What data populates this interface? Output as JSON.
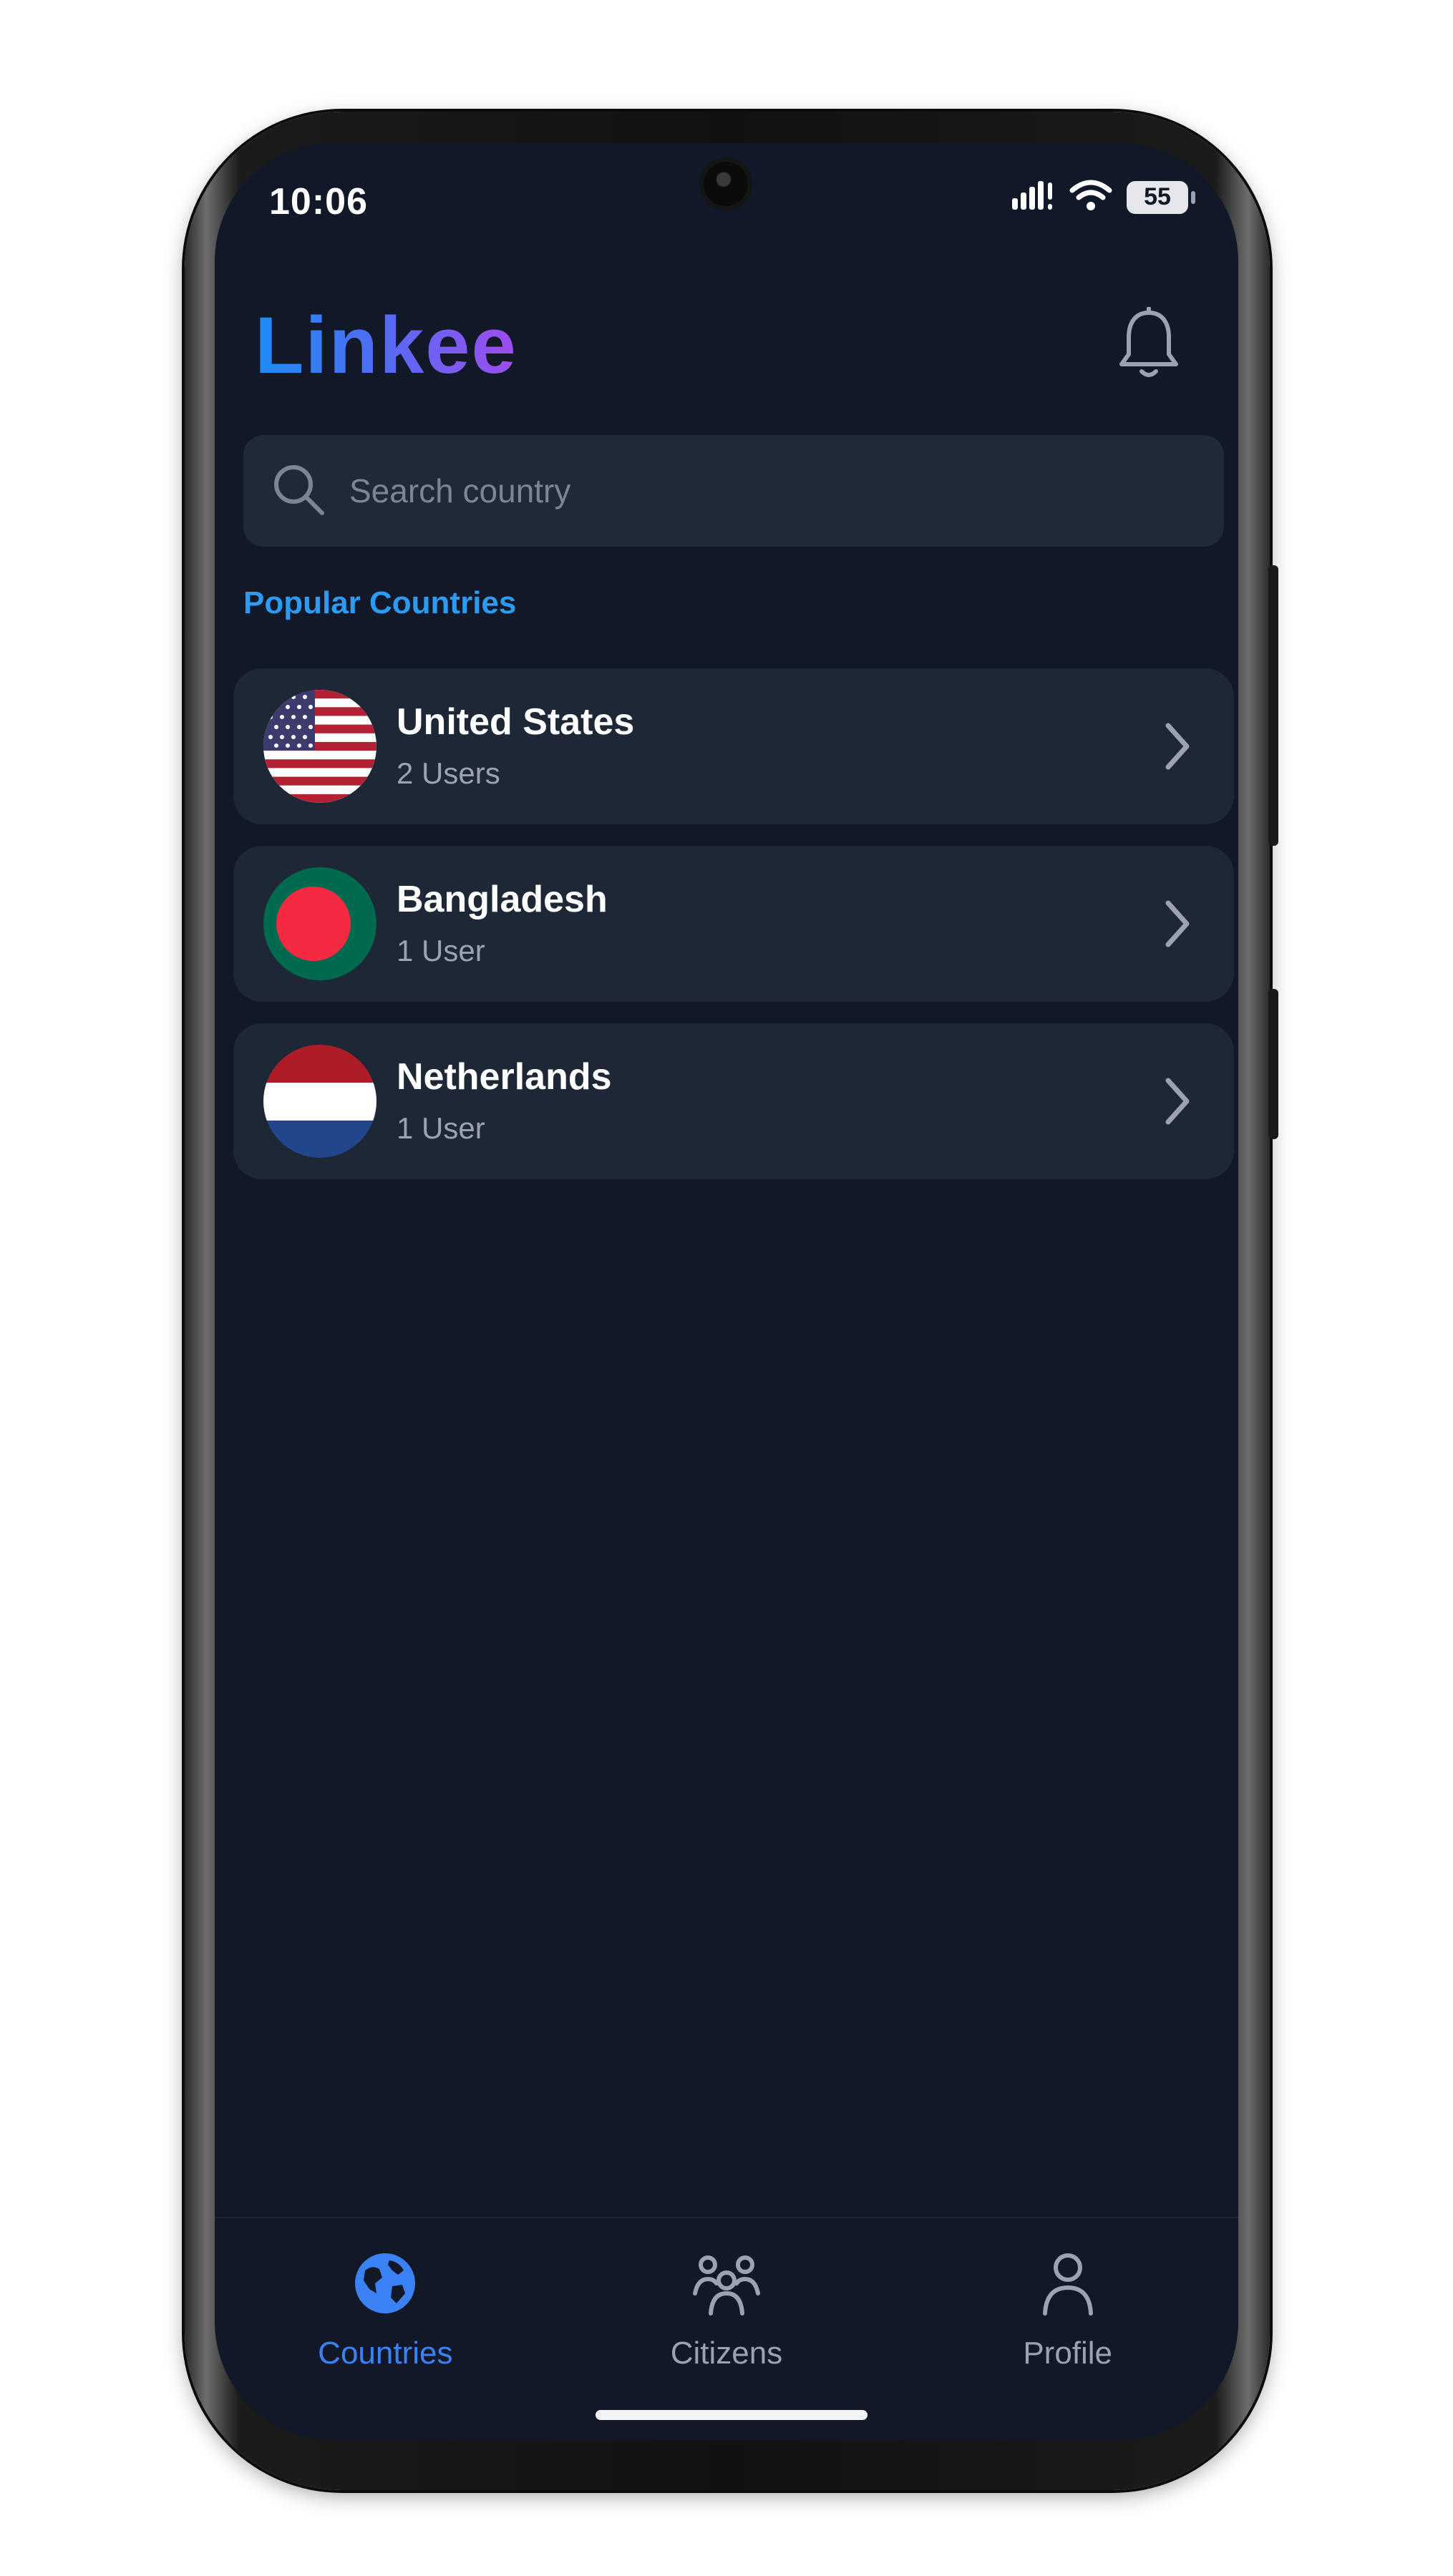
{
  "status_bar": {
    "time": "10:06",
    "battery": "55"
  },
  "header": {
    "logo_text": "Linkee",
    "logo_colors": [
      "#1d8df5",
      "#a04cf0"
    ],
    "notification_icon": "bell-icon"
  },
  "search": {
    "placeholder": "Search country",
    "value": ""
  },
  "section": {
    "title": "Popular Countries"
  },
  "countries": [
    {
      "name": "United States",
      "users": "2 Users",
      "flag": "us-flag-icon"
    },
    {
      "name": "Bangladesh",
      "users": "1 User",
      "flag": "bd-flag-icon"
    },
    {
      "name": "Netherlands",
      "users": "1 User",
      "flag": "nl-flag-icon"
    }
  ],
  "bottom_nav": {
    "items": [
      {
        "label": "Countries",
        "icon": "globe-icon",
        "active": true
      },
      {
        "label": "Citizens",
        "icon": "people-icon",
        "active": false
      },
      {
        "label": "Profile",
        "icon": "person-icon",
        "active": false
      }
    ]
  },
  "colors": {
    "background": "#111827",
    "card": "#1e2736",
    "accent": "#3b82f6",
    "section_title": "#2b9bf4"
  }
}
